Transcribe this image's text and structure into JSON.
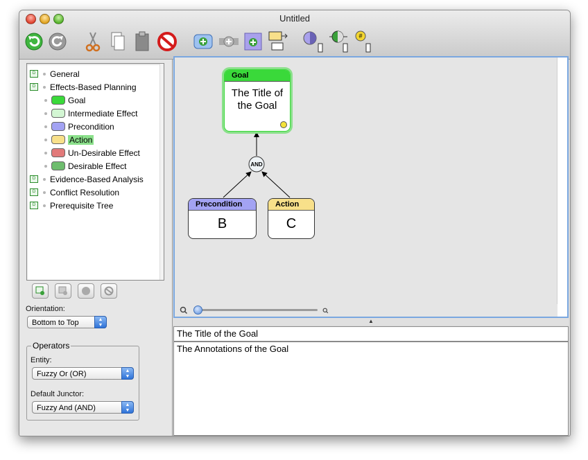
{
  "window": {
    "title": "Untitled"
  },
  "toolbar": {
    "icons": [
      "undo-icon",
      "redo-icon",
      "cut-icon",
      "copy-icon",
      "paste-icon",
      "delete-icon",
      "add-node-icon",
      "add-junctor-icon",
      "add-child-icon",
      "connect-icon",
      "entity-fill-icon",
      "junctor-fill-icon",
      "number-icon"
    ]
  },
  "outline": {
    "items": [
      {
        "label": "General",
        "kind": "root"
      },
      {
        "label": "Effects-Based Planning",
        "kind": "root"
      },
      {
        "label": "Goal",
        "kind": "child",
        "color": "#3ad93a"
      },
      {
        "label": "Intermediate Effect",
        "kind": "child",
        "color": "#d3f6d3"
      },
      {
        "label": "Precondition",
        "kind": "child",
        "color": "#a3a3f3"
      },
      {
        "label": "Action",
        "kind": "child",
        "color": "#f8e08a",
        "selected": true
      },
      {
        "label": "Un-Desirable Effect",
        "kind": "child",
        "color": "#e27a7a"
      },
      {
        "label": "Desirable Effect",
        "kind": "child",
        "color": "#6ebd6e"
      },
      {
        "label": "Evidence-Based Analysis",
        "kind": "root"
      },
      {
        "label": "Conflict Resolution",
        "kind": "root"
      },
      {
        "label": "Prerequisite Tree",
        "kind": "root"
      }
    ]
  },
  "orientation": {
    "label": "Orientation:",
    "value": "Bottom to Top"
  },
  "operators": {
    "title": "Operators",
    "entity_label": "Entity:",
    "entity_value": "Fuzzy Or (OR)",
    "junctor_label": "Default Junctor:",
    "junctor_value": "Fuzzy And (AND)"
  },
  "diagram": {
    "goal": {
      "type": "Goal",
      "text": "The Title of the Goal",
      "color": "#3ad93a"
    },
    "junctor": {
      "label": "AND"
    },
    "precondition": {
      "type": "Precondition",
      "text": "B",
      "color": "#a3a3f3"
    },
    "action": {
      "type": "Action",
      "text": "C",
      "color": "#f8e08a"
    }
  },
  "detail": {
    "title_value": "The Title of the Goal",
    "annotation_value": "The Annotations of the Goal"
  },
  "colors": {
    "selection": "#8be08b",
    "focus_ring": "#7aa7e0"
  }
}
